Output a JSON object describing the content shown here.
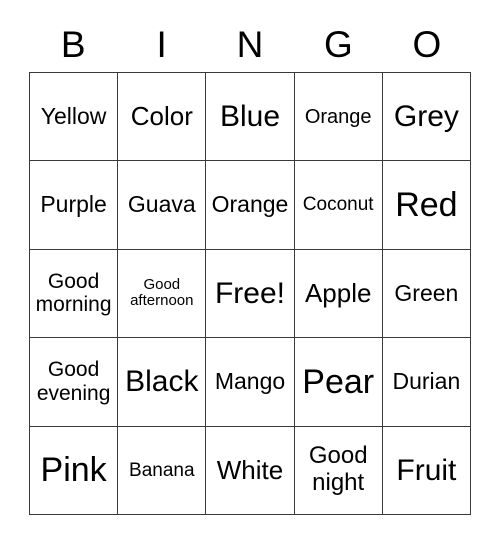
{
  "card": {
    "title": "BINGO",
    "header_letters": [
      "B",
      "I",
      "N",
      "G",
      "O"
    ],
    "free_space_label": "Free!",
    "rows": [
      [
        {
          "text": "Yellow",
          "size": "md"
        },
        {
          "text": "Color",
          "size": "lg"
        },
        {
          "text": "Blue",
          "size": "xl"
        },
        {
          "text": "Orange",
          "size": "sm"
        },
        {
          "text": "Grey",
          "size": "xl"
        }
      ],
      [
        {
          "text": "Purple",
          "size": "md"
        },
        {
          "text": "Guava",
          "size": "md"
        },
        {
          "text": "Orange",
          "size": "md"
        },
        {
          "text": "Coconut",
          "size": "xs"
        },
        {
          "text": "Red",
          "size": "xxl"
        }
      ],
      [
        {
          "text": "Good\nmorning",
          "size": "w-md"
        },
        {
          "text": "Good\nafternoon",
          "size": "xxs"
        },
        {
          "text": "Free!",
          "size": "xl"
        },
        {
          "text": "Apple",
          "size": "lg"
        },
        {
          "text": "Green",
          "size": "md"
        }
      ],
      [
        {
          "text": "Good\nevening",
          "size": "w-md"
        },
        {
          "text": "Black",
          "size": "xl"
        },
        {
          "text": "Mango",
          "size": "md"
        },
        {
          "text": "Pear",
          "size": "xxl"
        },
        {
          "text": "Durian",
          "size": "md"
        }
      ],
      [
        {
          "text": "Pink",
          "size": "xxl"
        },
        {
          "text": "Banana",
          "size": "xs"
        },
        {
          "text": "White",
          "size": "lg"
        },
        {
          "text": "Good\nnight",
          "size": "w-lg"
        },
        {
          "text": "Fruit",
          "size": "xl"
        }
      ]
    ]
  },
  "colors": {
    "border": "#3a3a3a",
    "background": "#ffffff",
    "text": "#000000"
  }
}
